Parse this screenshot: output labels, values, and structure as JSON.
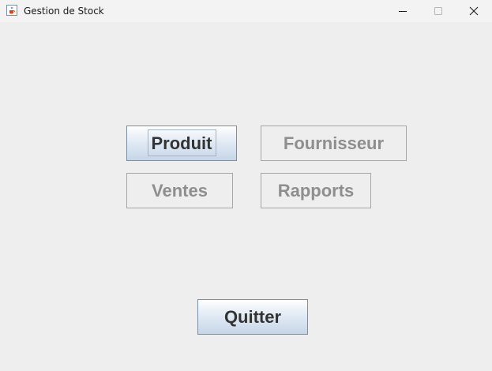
{
  "window": {
    "title": "Gestion de Stock",
    "icon": "java-cup-icon",
    "controls": [
      "minimize-icon",
      "maximize-icon",
      "close-icon"
    ]
  },
  "menu": {
    "buttons": [
      {
        "label": "Produit",
        "enabled": true,
        "focused": true
      },
      {
        "label": "Fournisseur",
        "enabled": false
      },
      {
        "label": "Ventes",
        "enabled": false
      },
      {
        "label": "Rapports",
        "enabled": false
      }
    ]
  },
  "footer": {
    "quit_label": "Quitter"
  },
  "colors": {
    "window_bg": "#eeeeee",
    "titlebar_bg": "#f3f3f3",
    "enabled_text": "#333333",
    "disabled_text": "#8e8e8e"
  }
}
